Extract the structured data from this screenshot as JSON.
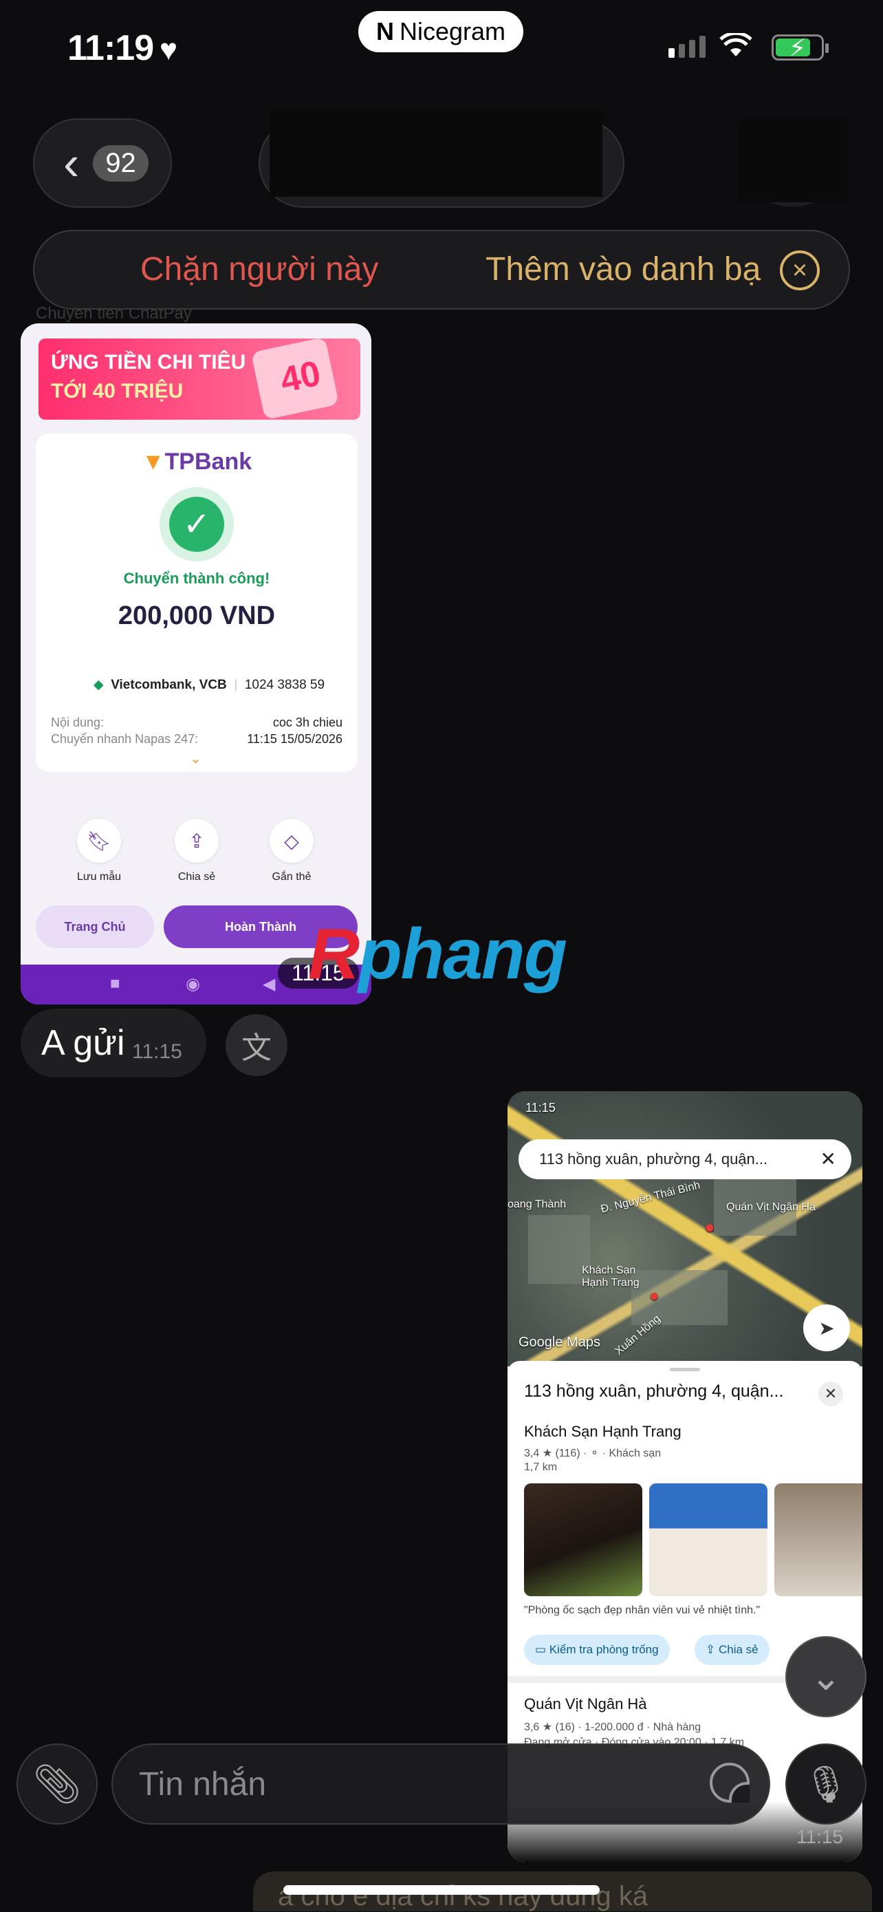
{
  "status_bar": {
    "time": "11:19",
    "heart": "♥",
    "app_pill": "Nicegram",
    "app_logo": "N"
  },
  "header": {
    "back_count": "92"
  },
  "action_bar": {
    "block": "Chặn người này",
    "add_contact": "Thêm vào danh bạ"
  },
  "background_text": {
    "top": "Chuyển tiền ChatPay"
  },
  "receipt": {
    "promo_line1": "ỨNG TIỀN CHI TIÊU",
    "promo_line2": "TỚI 40 TRIỆU",
    "promo_big": "40",
    "bank_brand": "TPBank",
    "success_text": "Chuyển thành công!",
    "amount": "200,000 VND",
    "bank_name": "Vietcombank, VCB",
    "account": "1024 3838 59",
    "rows": [
      {
        "label": "Nội dung:",
        "value": "coc 3h chieu"
      },
      {
        "label": "Chuyển nhanh Napas 247:",
        "value": "11:15 15/05/2026"
      }
    ],
    "actions": [
      "Lưu mẫu",
      "Chia sẻ",
      "Gắn thẻ"
    ],
    "home_button": "Trang Chủ",
    "done_button": "Hoàn Thành",
    "timestamp": "11:15"
  },
  "watermark": {
    "prefix": "R",
    "rest": "phang"
  },
  "text_message": {
    "text": "A gửi",
    "time": "11:15"
  },
  "map_card": {
    "status_time": "11:15",
    "search_text": "113 hồng xuân, phường 4, quận...",
    "map_labels": [
      "oang Thành",
      "Đ. Nguyễn Thái Bình",
      "Quán Vịt Ngân Hà",
      "Khách Sạn Hạnh Trang",
      "Google Maps",
      "Xuân Hồng"
    ],
    "sheet_title": "113 hồng xuân, phường 4, quận...",
    "place1": {
      "name": "Khách Sạn Hạnh Trang",
      "meta": "3,4 ★ (116) · ⚬ · Khách sạn",
      "distance": "1,7 km"
    },
    "review": "\"Phòng ốc sạch đẹp nhân viên vui vẻ nhiệt tình.\"",
    "chip_check": "Kiểm tra phòng trống",
    "chip_share": "Chia sẻ",
    "place2": {
      "name": "Quán Vịt Ngân Hà",
      "meta": "3,6 ★ (16) · 1-200.000 đ · Nhà hàng",
      "hours": "Đang mở cửa · Đóng cửa vào 20:00 · 1,7 km"
    },
    "timestamp": "11:15"
  },
  "input": {
    "placeholder": "Tin nhắn"
  },
  "bottom_ghost_text": "a cho e địa chỉ ks hay đúng ká"
}
